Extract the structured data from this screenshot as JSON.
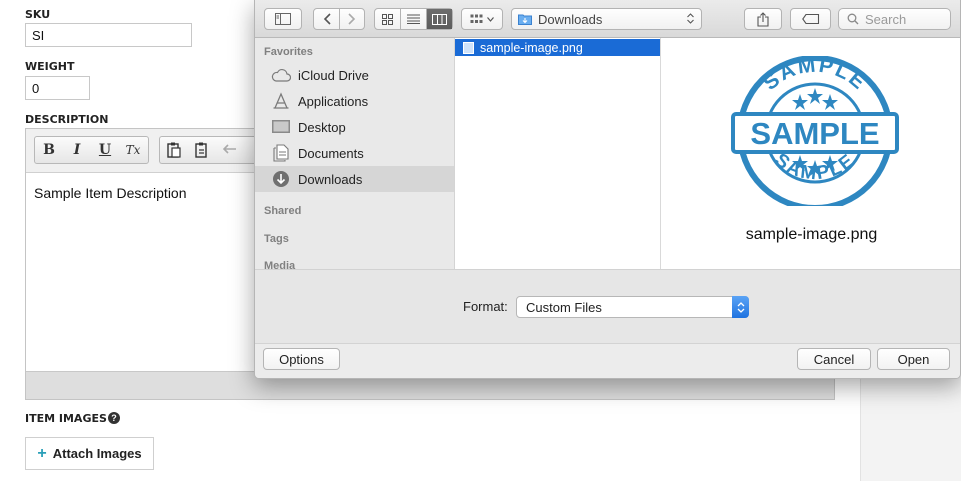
{
  "form": {
    "sku_label": "SKU",
    "sku_value": "SI",
    "weight_label": "WEIGHT",
    "weight_value": "0",
    "description_label": "DESCRIPTION",
    "description_text": "Sample Item Description",
    "editor_toolbar": {
      "bold": "B",
      "italic": "I",
      "underline": "U",
      "clear_format": "Tx"
    },
    "item_images_label": "ITEM IMAGES",
    "help_glyph": "?",
    "attach_plus": "+",
    "attach_label": "Attach Images"
  },
  "dialog": {
    "location": "Downloads",
    "search_placeholder": "Search",
    "sidebar": {
      "favorites_heading": "Favorites",
      "items": [
        {
          "label": "iCloud Drive",
          "icon": "cloud-icon"
        },
        {
          "label": "Applications",
          "icon": "applications-icon"
        },
        {
          "label": "Desktop",
          "icon": "desktop-icon"
        },
        {
          "label": "Documents",
          "icon": "documents-icon"
        },
        {
          "label": "Downloads",
          "icon": "downloads-icon",
          "selected": true
        }
      ],
      "shared_heading": "Shared",
      "tags_heading": "Tags",
      "media_heading": "Media"
    },
    "files": [
      {
        "name": "sample-image.png",
        "selected": true
      }
    ],
    "preview": {
      "file_name": "sample-image.png",
      "stamp_text": "SAMPLE",
      "stamp_color": "#2e87c1"
    },
    "format_label": "Format:",
    "format_value": "Custom Files",
    "options_label": "Options",
    "cancel_label": "Cancel",
    "open_label": "Open",
    "selection_color": "#1a6bd6"
  }
}
